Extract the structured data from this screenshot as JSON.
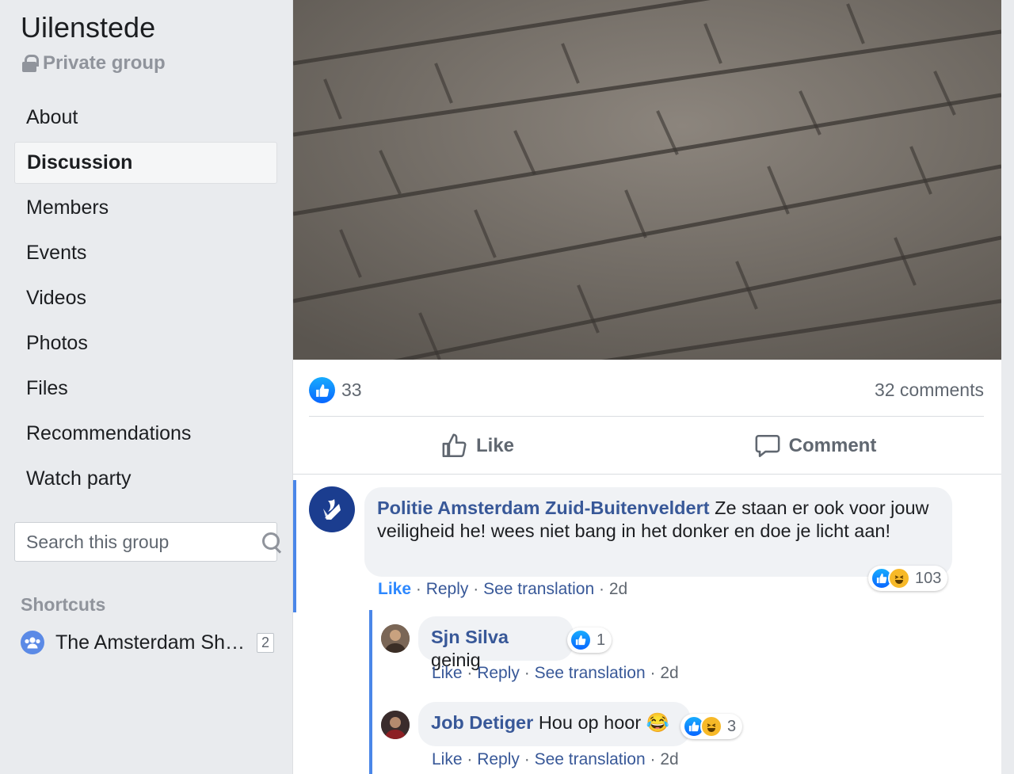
{
  "sidebar": {
    "group_name": "Uilenstede",
    "privacy_label": "Private group",
    "nav": [
      {
        "label": "About"
      },
      {
        "label": "Discussion"
      },
      {
        "label": "Members"
      },
      {
        "label": "Events"
      },
      {
        "label": "Videos"
      },
      {
        "label": "Photos"
      },
      {
        "label": "Files"
      },
      {
        "label": "Recommendations"
      },
      {
        "label": "Watch party"
      }
    ],
    "active_nav": "Discussion",
    "search_placeholder": "Search this group",
    "shortcuts_title": "Shortcuts",
    "shortcut": {
      "label": "The Amsterdam Sha...",
      "badge": "2"
    }
  },
  "post": {
    "likes_count": "33",
    "comments_count": "32 comments",
    "like_action": "Like",
    "comment_action": "Comment"
  },
  "comments": [
    {
      "author": "Politie Amsterdam Zuid-Buitenveldert",
      "text": "Ze staan er ook voor jouw veiligheid he! wees niet bang in het donker en doe je licht aan!",
      "like": "Like",
      "reply": "Reply",
      "see_translation": "See translation",
      "time": "2d",
      "reaction_count": "103"
    }
  ],
  "replies": [
    {
      "author": "Sjn Silva",
      "text": "geinig",
      "like": "Like",
      "reply": "Reply",
      "see_translation": "See translation",
      "time": "2d",
      "reaction_count": "1"
    },
    {
      "author": "Job Detiger",
      "text": "Hou op hoor 😂",
      "like": "Like",
      "reply": "Reply",
      "see_translation": "See translation",
      "time": "2d",
      "reaction_count": "3"
    }
  ],
  "colors": {
    "link_blue": "#385898",
    "like_blue": "#2d88ff",
    "thread_bar": "#4a86e8",
    "police_blue": "#1b3d8f"
  }
}
